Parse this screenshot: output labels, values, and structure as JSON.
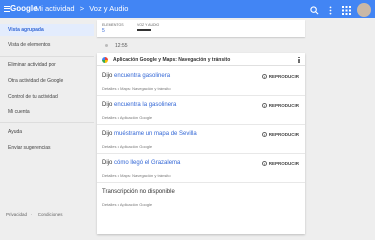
{
  "header": {
    "logo": "Google",
    "breadcrumb": [
      "Mi actividad",
      "Voz y Audio"
    ],
    "separator": ">",
    "icons": [
      "search-icon",
      "more-vert-icon",
      "apps-icon",
      "avatar"
    ]
  },
  "sidebar": {
    "items": [
      {
        "label": "Vista agrupada",
        "active": true
      },
      {
        "label": "Vista de elementos",
        "active": false
      },
      {
        "label": "Eliminar actividad por",
        "active": false
      },
      {
        "label": "Otra actividad de Google",
        "active": false
      },
      {
        "label": "Control de tu actividad",
        "active": false
      },
      {
        "label": "Mi cuenta",
        "active": false
      },
      {
        "label": "Ayuda",
        "active": false
      },
      {
        "label": "Enviar sugerencias",
        "active": false
      }
    ],
    "footer": [
      "Privacidad",
      "Condiciones"
    ]
  },
  "stats": {
    "elementos_label": "ELEMENTOS",
    "elementos_value": "5",
    "voz_label": "VOZ Y AUDIO"
  },
  "timeline": {
    "time": "12:55"
  },
  "card": {
    "title": "Aplicación Google y Maps: Navegación y tránsito",
    "play_label": "REPRODUCIR",
    "entries": [
      {
        "prefix": "Dijo ",
        "query": "encuentra gasolinera",
        "meta": [
          "Detalles",
          "Maps: Navegación y tránsito"
        ]
      },
      {
        "prefix": "Dijo ",
        "query": "encuentra la gasolinera",
        "meta": [
          "Detalles",
          "Aplicación Google"
        ]
      },
      {
        "prefix": "Dijo ",
        "query": "muéstrame un mapa de Sevilla",
        "meta": [
          "Detalles",
          "Aplicación Google"
        ]
      },
      {
        "prefix": "Dijo ",
        "query": "cómo llegó el Grazalema",
        "meta": [
          "Detalles",
          "Maps: Navegación y tránsito"
        ]
      },
      {
        "prefix": "",
        "query": "Transcripción no disponible",
        "meta": [
          "Detalles",
          "Aplicación Google"
        ]
      }
    ],
    "meta_separator": "•"
  },
  "colors": {
    "topbar": "#4285f4",
    "accent": "#3367d6",
    "background": "#eeeeee"
  }
}
